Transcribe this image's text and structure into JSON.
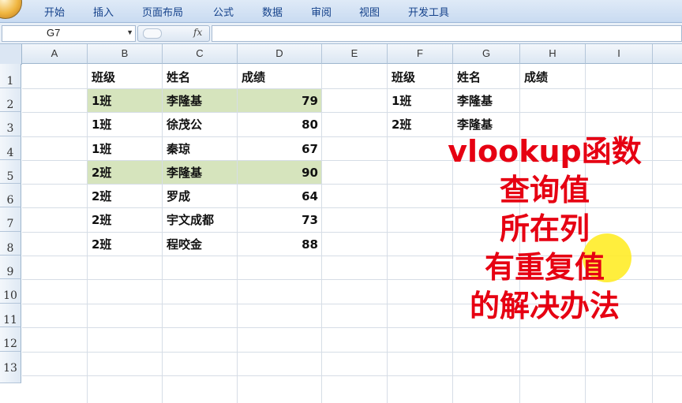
{
  "ribbon": {
    "tabs": [
      "开始",
      "插入",
      "页面布局",
      "公式",
      "数据",
      "审阅",
      "视图",
      "开发工具"
    ]
  },
  "formula_bar": {
    "name_box": "G7",
    "fx_label": "fx",
    "formula": ""
  },
  "sheet": {
    "columns": [
      "A",
      "B",
      "C",
      "D",
      "E",
      "F",
      "G",
      "H",
      "I"
    ],
    "rows": [
      "1",
      "2",
      "3",
      "4",
      "5",
      "6",
      "7",
      "8",
      "9",
      "10",
      "11",
      "12",
      "13"
    ],
    "source_table": {
      "headers": [
        "班级",
        "姓名",
        "成绩"
      ],
      "rows": [
        [
          "1班",
          "李隆基",
          "79"
        ],
        [
          "1班",
          "徐茂公",
          "80"
        ],
        [
          "1班",
          "秦琼",
          "67"
        ],
        [
          "2班",
          "李隆基",
          "90"
        ],
        [
          "2班",
          "罗成",
          "64"
        ],
        [
          "2班",
          "宇文成都",
          "73"
        ],
        [
          "2班",
          "程咬金",
          "88"
        ]
      ]
    },
    "lookup_table": {
      "headers": [
        "班级",
        "姓名",
        "成绩"
      ],
      "rows": [
        [
          "1班",
          "李隆基",
          ""
        ],
        [
          "2班",
          "李隆基",
          ""
        ]
      ]
    }
  },
  "overlay_lines": [
    "vlookup函数",
    "查询值",
    "所在列",
    "有重复值",
    "的解决办法"
  ],
  "colors": {
    "highlight": "#d6e4bd",
    "overlay_text": "#e60012",
    "pointer": "#ffec28"
  }
}
